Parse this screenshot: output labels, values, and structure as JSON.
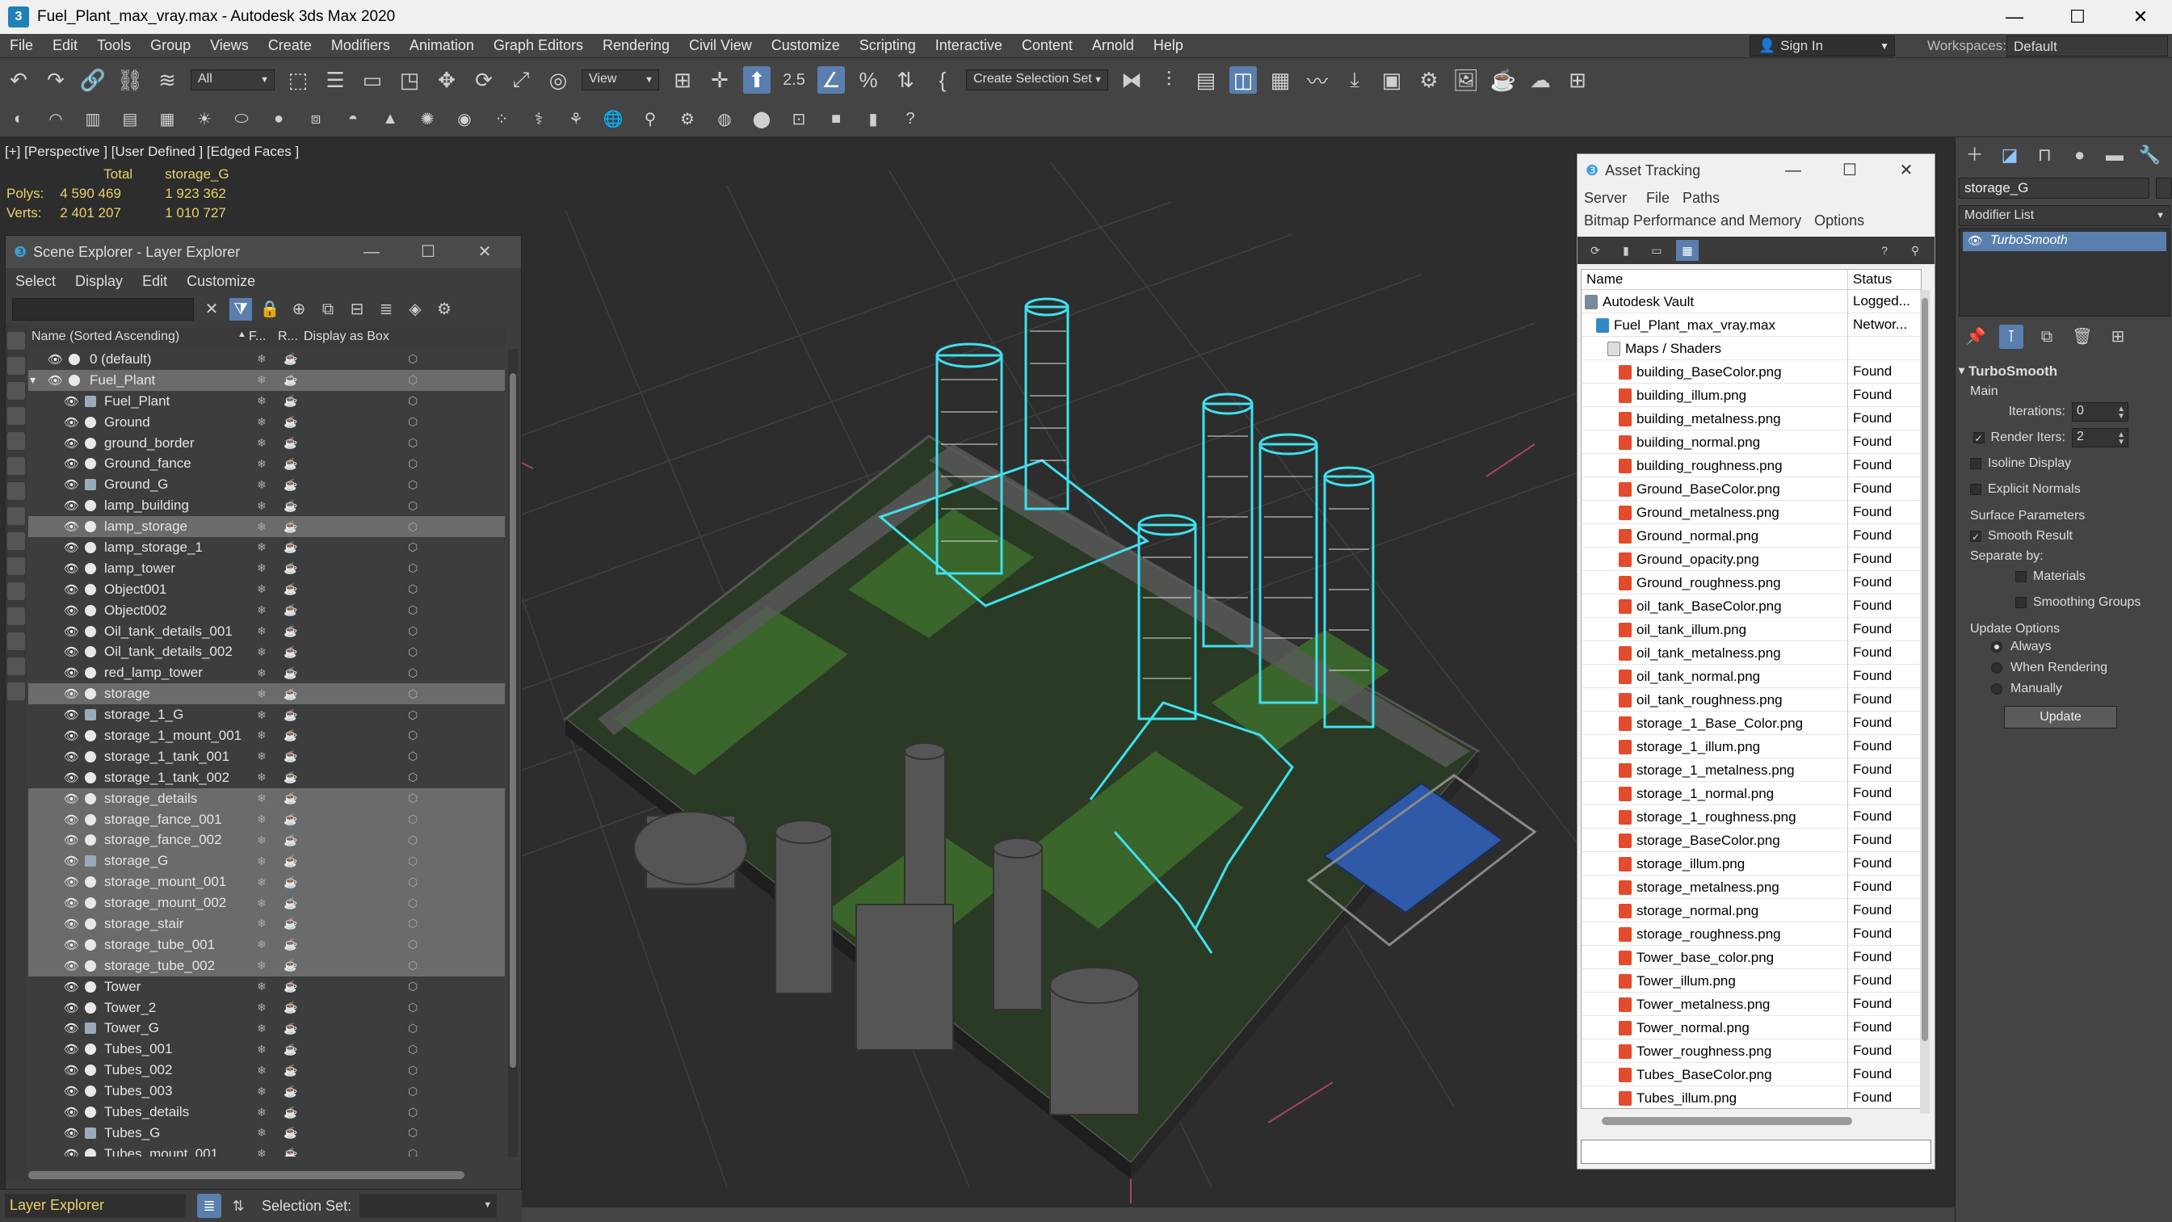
{
  "window": {
    "title": "Fuel_Plant_max_vray.max - Autodesk 3ds Max 2020",
    "app_icon": "3"
  },
  "menu": [
    "File",
    "Edit",
    "Tools",
    "Group",
    "Views",
    "Create",
    "Modifiers",
    "Animation",
    "Graph Editors",
    "Rendering",
    "Civil View",
    "Customize",
    "Scripting",
    "Interactive",
    "Content",
    "Arnold",
    "Help"
  ],
  "account": {
    "sign_in": "Sign In",
    "workspaces_label": "Workspaces:",
    "workspace_value": "Default"
  },
  "toolbar": {
    "filter_select": "All",
    "view_select": "View",
    "selection_set": "Create Selection Set",
    "snap_label": "2.5"
  },
  "viewport": {
    "label": "[+] [Perspective ] [User Defined ] [Edged Faces ]",
    "stats": {
      "col_total": "Total",
      "col_selected": "storage_G",
      "polys_label": "Polys:",
      "polys_total": "4 590 469",
      "polys_selected": "1 923 362",
      "verts_label": "Verts:",
      "verts_total": "2 401 207",
      "verts_selected": "1 010 727"
    }
  },
  "scene_explorer": {
    "title": "Scene Explorer - Layer Explorer",
    "menu": [
      "Select",
      "Display",
      "Edit",
      "Customize"
    ],
    "columns": {
      "name": "Name (Sorted Ascending)",
      "sort_arrow": "▲",
      "freeze": "F...",
      "render": "R...",
      "display_box": "Display as Box"
    },
    "rows": [
      {
        "label": "0 (default)",
        "indent": 0,
        "selected": false,
        "type": "layer"
      },
      {
        "label": "Fuel_Plant",
        "indent": 0,
        "selected": true,
        "type": "layer"
      },
      {
        "label": "Fuel_Plant",
        "indent": 1,
        "selected": false,
        "type": "group"
      },
      {
        "label": "Ground",
        "indent": 1,
        "selected": false,
        "type": "obj"
      },
      {
        "label": "ground_border",
        "indent": 1,
        "selected": false,
        "type": "obj"
      },
      {
        "label": "Ground_fance",
        "indent": 1,
        "selected": false,
        "type": "obj"
      },
      {
        "label": "Ground_G",
        "indent": 1,
        "selected": false,
        "type": "group"
      },
      {
        "label": "lamp_building",
        "indent": 1,
        "selected": false,
        "type": "obj"
      },
      {
        "label": "lamp_storage",
        "indent": 1,
        "selected": true,
        "type": "obj"
      },
      {
        "label": "lamp_storage_1",
        "indent": 1,
        "selected": false,
        "type": "obj"
      },
      {
        "label": "lamp_tower",
        "indent": 1,
        "selected": false,
        "type": "obj"
      },
      {
        "label": "Object001",
        "indent": 1,
        "selected": false,
        "type": "obj"
      },
      {
        "label": "Object002",
        "indent": 1,
        "selected": false,
        "type": "obj"
      },
      {
        "label": "Oil_tank_details_001",
        "indent": 1,
        "selected": false,
        "type": "obj"
      },
      {
        "label": "Oil_tank_details_002",
        "indent": 1,
        "selected": false,
        "type": "obj"
      },
      {
        "label": "red_lamp_tower",
        "indent": 1,
        "selected": false,
        "type": "obj"
      },
      {
        "label": "storage",
        "indent": 1,
        "selected": true,
        "type": "obj"
      },
      {
        "label": "storage_1_G",
        "indent": 1,
        "selected": false,
        "type": "group"
      },
      {
        "label": "storage_1_mount_001",
        "indent": 1,
        "selected": false,
        "type": "obj"
      },
      {
        "label": "storage_1_tank_001",
        "indent": 1,
        "selected": false,
        "type": "obj"
      },
      {
        "label": "storage_1_tank_002",
        "indent": 1,
        "selected": false,
        "type": "obj"
      },
      {
        "label": "storage_details",
        "indent": 1,
        "selected": true,
        "type": "obj"
      },
      {
        "label": "storage_fance_001",
        "indent": 1,
        "selected": true,
        "type": "obj"
      },
      {
        "label": "storage_fance_002",
        "indent": 1,
        "selected": true,
        "type": "obj"
      },
      {
        "label": "storage_G",
        "indent": 1,
        "selected": true,
        "type": "group"
      },
      {
        "label": "storage_mount_001",
        "indent": 1,
        "selected": true,
        "type": "obj"
      },
      {
        "label": "storage_mount_002",
        "indent": 1,
        "selected": true,
        "type": "obj"
      },
      {
        "label": "storage_stair",
        "indent": 1,
        "selected": true,
        "type": "obj"
      },
      {
        "label": "storage_tube_001",
        "indent": 1,
        "selected": true,
        "type": "obj"
      },
      {
        "label": "storage_tube_002",
        "indent": 1,
        "selected": true,
        "type": "obj"
      },
      {
        "label": "Tower",
        "indent": 1,
        "selected": false,
        "type": "obj"
      },
      {
        "label": "Tower_2",
        "indent": 1,
        "selected": false,
        "type": "obj"
      },
      {
        "label": "Tower_G",
        "indent": 1,
        "selected": false,
        "type": "group"
      },
      {
        "label": "Tubes_001",
        "indent": 1,
        "selected": false,
        "type": "obj"
      },
      {
        "label": "Tubes_002",
        "indent": 1,
        "selected": false,
        "type": "obj"
      },
      {
        "label": "Tubes_003",
        "indent": 1,
        "selected": false,
        "type": "obj"
      },
      {
        "label": "Tubes_details",
        "indent": 1,
        "selected": false,
        "type": "obj"
      },
      {
        "label": "Tubes_G",
        "indent": 1,
        "selected": false,
        "type": "group"
      },
      {
        "label": "Tubes_mount_001",
        "indent": 1,
        "selected": false,
        "type": "obj"
      }
    ]
  },
  "bottom_bar": {
    "explorer_name": "Layer Explorer",
    "selection_set_label": "Selection Set:"
  },
  "asset_tracking": {
    "title": "Asset Tracking",
    "menu1": [
      "Server",
      "File",
      "Paths"
    ],
    "menu2": [
      "Bitmap Performance and Memory",
      "Options"
    ],
    "col_name": "Name",
    "col_status": "Status",
    "rows": [
      {
        "name": "Autodesk Vault",
        "status": "Logged...",
        "kind": "vault",
        "indent": 1
      },
      {
        "name": "Fuel_Plant_max_vray.max",
        "status": "Networ...",
        "kind": "max",
        "indent": 2
      },
      {
        "name": "Maps / Shaders",
        "status": "",
        "kind": "folder",
        "indent": 3
      },
      {
        "name": "building_BaseColor.png",
        "status": "Found",
        "kind": "file",
        "indent": 4
      },
      {
        "name": "building_illum.png",
        "status": "Found",
        "kind": "file",
        "indent": 4
      },
      {
        "name": "building_metalness.png",
        "status": "Found",
        "kind": "file",
        "indent": 4
      },
      {
        "name": "building_normal.png",
        "status": "Found",
        "kind": "file",
        "indent": 4
      },
      {
        "name": "building_roughness.png",
        "status": "Found",
        "kind": "file",
        "indent": 4
      },
      {
        "name": "Ground_BaseColor.png",
        "status": "Found",
        "kind": "file",
        "indent": 4
      },
      {
        "name": "Ground_metalness.png",
        "status": "Found",
        "kind": "file",
        "indent": 4
      },
      {
        "name": "Ground_normal.png",
        "status": "Found",
        "kind": "file",
        "indent": 4
      },
      {
        "name": "Ground_opacity.png",
        "status": "Found",
        "kind": "file",
        "indent": 4
      },
      {
        "name": "Ground_roughness.png",
        "status": "Found",
        "kind": "file",
        "indent": 4
      },
      {
        "name": "oil_tank_BaseColor.png",
        "status": "Found",
        "kind": "file",
        "indent": 4
      },
      {
        "name": "oil_tank_illum.png",
        "status": "Found",
        "kind": "file",
        "indent": 4
      },
      {
        "name": "oil_tank_metalness.png",
        "status": "Found",
        "kind": "file",
        "indent": 4
      },
      {
        "name": "oil_tank_normal.png",
        "status": "Found",
        "kind": "file",
        "indent": 4
      },
      {
        "name": "oil_tank_roughness.png",
        "status": "Found",
        "kind": "file",
        "indent": 4
      },
      {
        "name": "storage_1_Base_Color.png",
        "status": "Found",
        "kind": "file",
        "indent": 4
      },
      {
        "name": "storage_1_illum.png",
        "status": "Found",
        "kind": "file",
        "indent": 4
      },
      {
        "name": "storage_1_metalness.png",
        "status": "Found",
        "kind": "file",
        "indent": 4
      },
      {
        "name": "storage_1_normal.png",
        "status": "Found",
        "kind": "file",
        "indent": 4
      },
      {
        "name": "storage_1_roughness.png",
        "status": "Found",
        "kind": "file",
        "indent": 4
      },
      {
        "name": "storage_BaseColor.png",
        "status": "Found",
        "kind": "file",
        "indent": 4
      },
      {
        "name": "storage_illum.png",
        "status": "Found",
        "kind": "file",
        "indent": 4
      },
      {
        "name": "storage_metalness.png",
        "status": "Found",
        "kind": "file",
        "indent": 4
      },
      {
        "name": "storage_normal.png",
        "status": "Found",
        "kind": "file",
        "indent": 4
      },
      {
        "name": "storage_roughness.png",
        "status": "Found",
        "kind": "file",
        "indent": 4
      },
      {
        "name": "Tower_base_color.png",
        "status": "Found",
        "kind": "file",
        "indent": 4
      },
      {
        "name": "Tower_illum.png",
        "status": "Found",
        "kind": "file",
        "indent": 4
      },
      {
        "name": "Tower_metalness.png",
        "status": "Found",
        "kind": "file",
        "indent": 4
      },
      {
        "name": "Tower_normal.png",
        "status": "Found",
        "kind": "file",
        "indent": 4
      },
      {
        "name": "Tower_roughness.png",
        "status": "Found",
        "kind": "file",
        "indent": 4
      },
      {
        "name": "Tubes_BaseColor.png",
        "status": "Found",
        "kind": "file",
        "indent": 4
      },
      {
        "name": "Tubes_illum.png",
        "status": "Found",
        "kind": "file",
        "indent": 4
      }
    ]
  },
  "command_panel": {
    "object_name": "storage_G",
    "modifier_list": "Modifier List",
    "stack_item": "TurboSmooth",
    "rollout_title": "TurboSmooth",
    "main_label": "Main",
    "iterations_label": "Iterations:",
    "iterations_value": "0",
    "render_iters_label": "Render Iters:",
    "render_iters_value": "2",
    "isoline_label": "Isoline Display",
    "explicit_normals_label": "Explicit Normals",
    "surface_params_label": "Surface Parameters",
    "smooth_result_label": "Smooth Result",
    "separate_by_label": "Separate by:",
    "materials_label": "Materials",
    "smoothing_groups_label": "Smoothing Groups",
    "update_options_label": "Update Options",
    "always_label": "Always",
    "when_rendering_label": "When Rendering",
    "manually_label": "Manually",
    "update_button": "Update"
  },
  "colors": {
    "accent": "#5a7fae",
    "selection_wire": "#3fe0ee",
    "stats_text": "#e8d26a"
  }
}
